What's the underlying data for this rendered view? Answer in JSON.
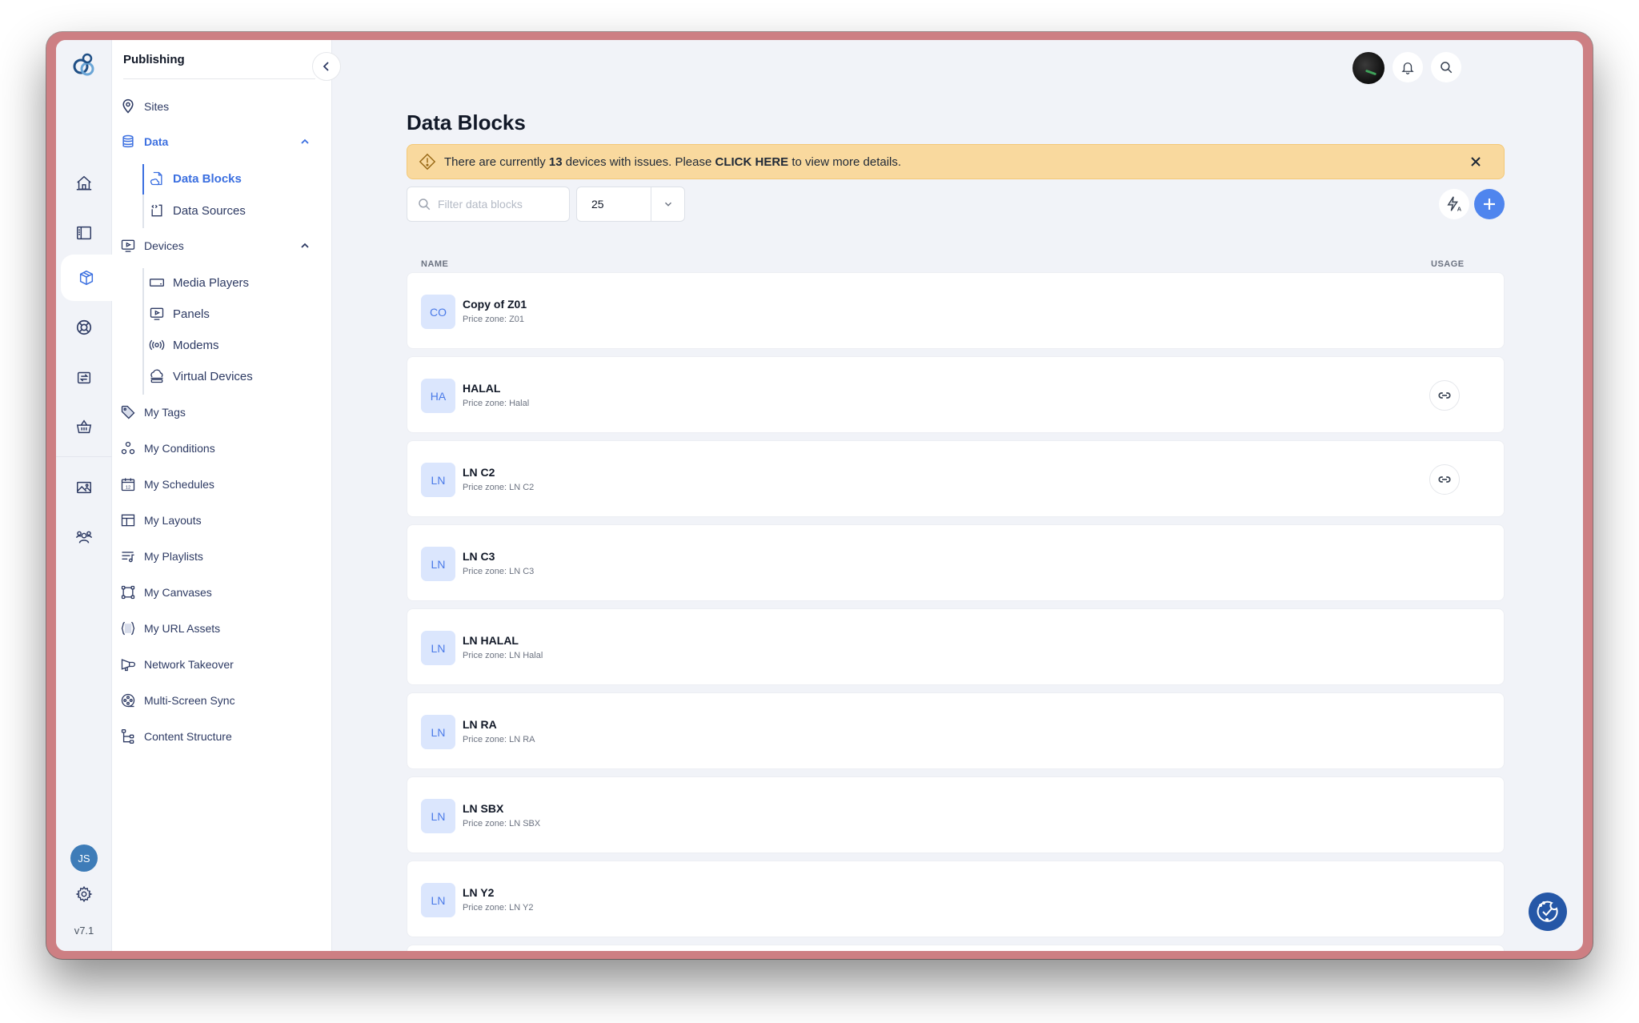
{
  "app": {
    "logo_icon": "app-logo-icon",
    "version": "v7.1",
    "user_initials": "JS"
  },
  "rail": {
    "items": [
      {
        "name": "home",
        "icon": "home-icon",
        "active": false
      },
      {
        "name": "sidebar",
        "icon": "sidebar-layout-icon",
        "active": false
      },
      {
        "name": "publishing",
        "icon": "package-box-icon",
        "active": true
      },
      {
        "name": "support",
        "icon": "lifebuoy-icon",
        "active": false
      },
      {
        "name": "sync",
        "icon": "switch-arrows-icon",
        "active": false
      },
      {
        "name": "store",
        "icon": "basket-icon",
        "active": false
      },
      {
        "name": "media",
        "icon": "image-icon",
        "active": false
      },
      {
        "name": "users",
        "icon": "users-icon",
        "active": false
      }
    ],
    "settings_icon": "gear-icon"
  },
  "subnav": {
    "title": "Publishing",
    "collapse_icon": "chevron-left-icon",
    "items": {
      "sites": "Sites",
      "data": "Data",
      "data_blocks": "Data Blocks",
      "data_sources": "Data Sources",
      "devices": "Devices",
      "media_players": "Media Players",
      "panels": "Panels",
      "modems": "Modems",
      "virtual_devices": "Virtual Devices",
      "my_tags": "My Tags",
      "my_conditions": "My Conditions",
      "my_schedules": "My Schedules",
      "my_layouts": "My Layouts",
      "my_playlists": "My Playlists",
      "my_canvases": "My Canvases",
      "my_url_assets": "My URL Assets",
      "network_takeover": "Network Takeover",
      "multi_screen_sync": "Multi-Screen Sync",
      "content_structure": "Content Structure"
    }
  },
  "header": {
    "notifications_icon": "bell-icon",
    "search_icon": "search-icon"
  },
  "main": {
    "title": "Data Blocks",
    "alert": {
      "prefix": "There are currently ",
      "count": "13",
      "middle": " devices with issues. Please ",
      "cta": "CLICK HERE",
      "suffix": " to view more details."
    },
    "filter": {
      "placeholder": "Filter data blocks",
      "value": ""
    },
    "page_size": "25",
    "columns": {
      "name": "NAME",
      "usage": "USAGE"
    },
    "rows": [
      {
        "badge": "CO",
        "name": "Copy of Z01",
        "sub": "Price zone: Z01",
        "has_usage": false
      },
      {
        "badge": "HA",
        "name": "HALAL",
        "sub": "Price zone: Halal",
        "has_usage": true
      },
      {
        "badge": "LN",
        "name": "LN C2",
        "sub": "Price zone: LN C2",
        "has_usage": true
      },
      {
        "badge": "LN",
        "name": "LN C3",
        "sub": "Price zone: LN C3",
        "has_usage": false
      },
      {
        "badge": "LN",
        "name": "LN HALAL",
        "sub": "Price zone: LN Halal",
        "has_usage": false
      },
      {
        "badge": "LN",
        "name": "LN RA",
        "sub": "Price zone: LN RA",
        "has_usage": false
      },
      {
        "badge": "LN",
        "name": "LN SBX",
        "sub": "Price zone: LN SBX",
        "has_usage": false
      },
      {
        "badge": "LN",
        "name": "LN Y2",
        "sub": "Price zone: LN Y2",
        "has_usage": false
      }
    ]
  },
  "colors": {
    "accent": "#3b6fe0",
    "add_button": "#4f85ee",
    "alert_bg": "#f9d99e",
    "badge_bg": "#dbe6fd",
    "cookie_button": "#2557a7",
    "frame": "#cd7f83"
  }
}
